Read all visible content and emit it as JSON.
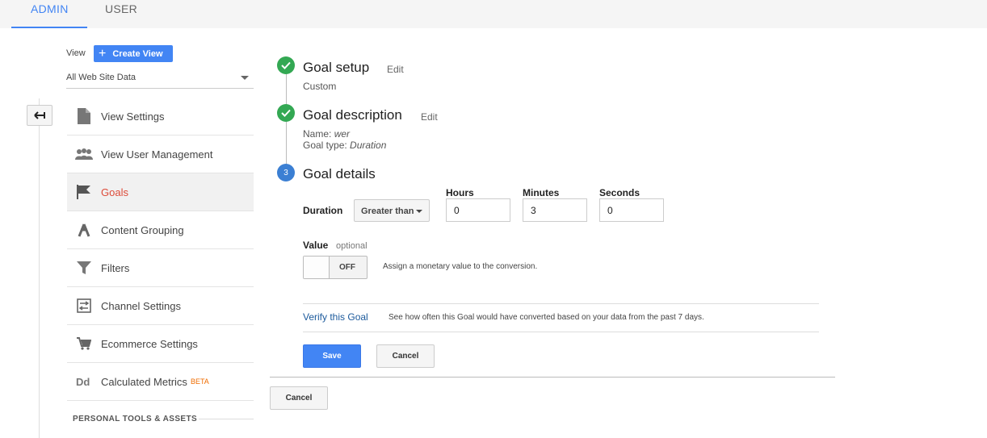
{
  "tabs": {
    "admin": "ADMIN",
    "user": "USER"
  },
  "view": {
    "label": "View",
    "create_button": "Create View",
    "selected": "All Web Site Data"
  },
  "sidebar": {
    "items": [
      {
        "label": "View Settings",
        "icon": "document-icon"
      },
      {
        "label": "View User Management",
        "icon": "people-icon"
      },
      {
        "label": "Goals",
        "icon": "flag-icon",
        "active": true
      },
      {
        "label": "Content Grouping",
        "icon": "grouping-icon"
      },
      {
        "label": "Filters",
        "icon": "filter-icon"
      },
      {
        "label": "Channel Settings",
        "icon": "channel-icon"
      },
      {
        "label": "Ecommerce Settings",
        "icon": "cart-icon"
      },
      {
        "label": "Calculated Metrics",
        "icon": "dd-icon",
        "badge": "BETA"
      }
    ],
    "section_title": "PERSONAL TOOLS & ASSETS"
  },
  "goal_setup": {
    "title": "Goal setup",
    "edit": "Edit",
    "value": "Custom"
  },
  "goal_description": {
    "title": "Goal description",
    "edit": "Edit",
    "name_label": "Name:",
    "name_value": "wer",
    "type_label": "Goal type:",
    "type_value": "Duration"
  },
  "goal_details": {
    "step_number": "3",
    "title": "Goal details",
    "duration_label": "Duration",
    "comparison": "Greater than",
    "hours_label": "Hours",
    "hours_value": "0",
    "minutes_label": "Minutes",
    "minutes_value": "3",
    "seconds_label": "Seconds",
    "seconds_value": "0",
    "value_label": "Value",
    "value_optional": "optional",
    "toggle_state": "OFF",
    "toggle_desc": "Assign a monetary value to the conversion.",
    "verify_link": "Verify this Goal",
    "verify_desc": "See how often this Goal would have converted based on your data from the past 7 days.",
    "save": "Save",
    "cancel": "Cancel"
  },
  "outer_cancel": "Cancel",
  "colors": {
    "accent": "#4285f4",
    "success": "#33a853",
    "active_nav": "#dd4b39",
    "link": "#1c5a9c",
    "beta": "#ef6c00"
  }
}
